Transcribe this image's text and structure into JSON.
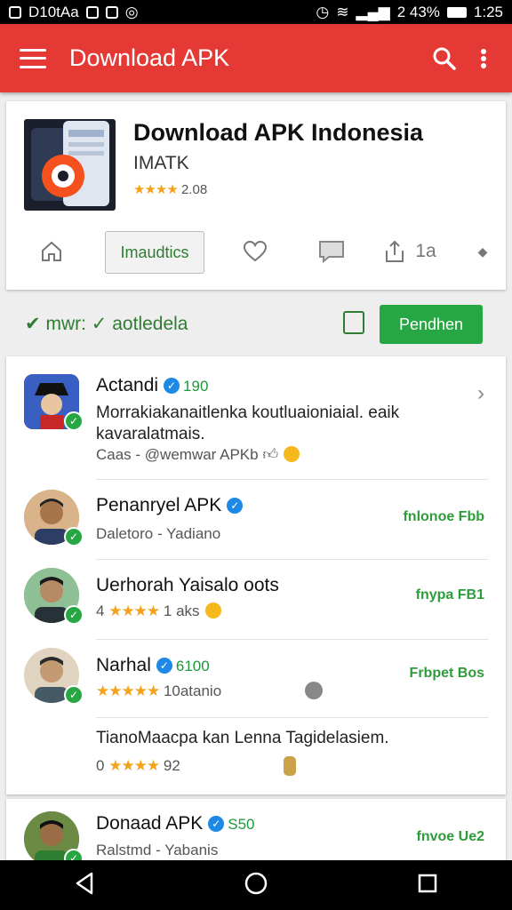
{
  "status_bar": {
    "left_text": "D10tAa",
    "right_text": "2 43%",
    "time": "1:25"
  },
  "app_bar": {
    "title": "Download APK",
    "color": "#e53935"
  },
  "app_card": {
    "title": "Download APK Indonesia",
    "developer": "IMATK",
    "stars": "★★★★",
    "rating_text": "2.08",
    "primary_action": "Imaudtics",
    "share_count": "1a"
  },
  "verify_bar": {
    "label": "mwr:",
    "text": "aotledela",
    "button": "Pendhen"
  },
  "list": [
    {
      "name": "Actandi",
      "count": "190",
      "description": "Morrakiakanaitlenka koutluaioniaial. eaik kavaralatmais.",
      "sub": "Caas - @wemwar APKb"
    },
    {
      "name": "Penanryel APK",
      "sub": "Daletoro - Yadiano",
      "right": "fnlonoe Fbb"
    },
    {
      "name": "Uerhorah Yaisalo oots",
      "rating_prefix": "4",
      "stars": "★★★★",
      "sub": "1 aks",
      "right": "fnypa FB1"
    },
    {
      "name": "Narhal",
      "count": "6100",
      "stars": "★★★★★",
      "sub": "10atanio",
      "right": "Frbpet Bos"
    },
    {
      "description": "TianoMaacpa kan Lenna Tagidelasiem.",
      "rating_prefix": "0",
      "stars": "★★★★",
      "sub": "92"
    }
  ],
  "list2": {
    "name": "Donaad APK",
    "count": "S50",
    "sub": "Ralstmd - Yabanis",
    "right": "fnvoe Ue2"
  }
}
